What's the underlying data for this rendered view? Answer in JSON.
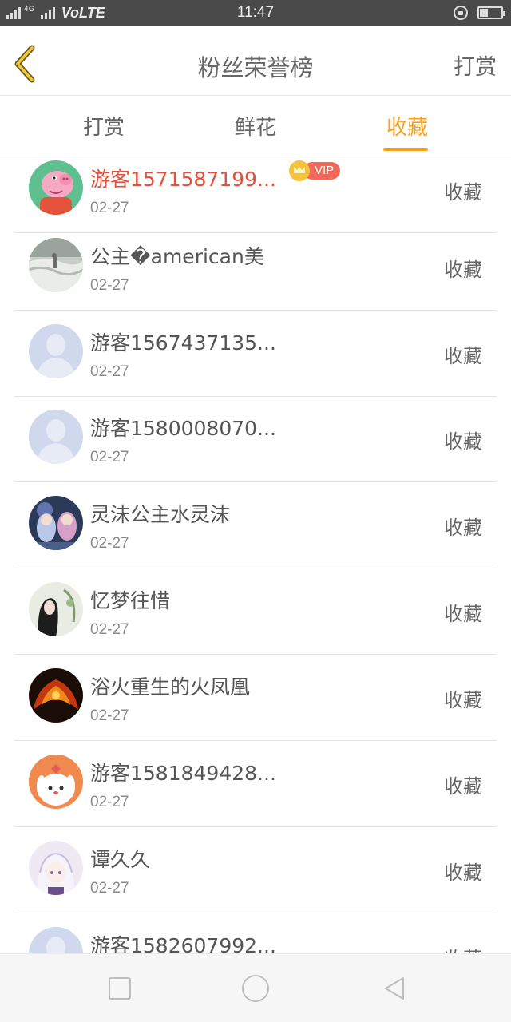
{
  "status_bar": {
    "network": "4G",
    "carrier_label": "VoLTE",
    "time": "11:47",
    "battery_level": 0.4
  },
  "header": {
    "title": "粉丝荣誉榜",
    "action_label": "打赏"
  },
  "tabs": [
    {
      "label": "打赏",
      "active": false
    },
    {
      "label": "鲜花",
      "active": false
    },
    {
      "label": "收藏",
      "active": true
    }
  ],
  "list": {
    "items": [
      {
        "name": "游客1571587199...",
        "date": "02-27",
        "action": "收藏",
        "highlight": true,
        "vip_label": "VIP",
        "avatar": "peppa-pig-avatar"
      },
      {
        "name": "公主�american美",
        "date": "02-27",
        "action": "收藏",
        "avatar": "photo-avatar"
      },
      {
        "name": "游客1567437135...",
        "date": "02-27",
        "action": "收藏",
        "avatar": "default-user-avatar"
      },
      {
        "name": "游客1580008070...",
        "date": "02-27",
        "action": "收藏",
        "avatar": "default-user-avatar"
      },
      {
        "name": "灵沫公主水灵沫",
        "date": "02-27",
        "action": "收藏",
        "avatar": "anime-girls-avatar"
      },
      {
        "name": "忆梦往惜",
        "date": "02-27",
        "action": "收藏",
        "avatar": "portrait-avatar"
      },
      {
        "name": "浴火重生的火凤凰",
        "date": "02-27",
        "action": "收藏",
        "avatar": "phoenix-avatar"
      },
      {
        "name": "游客1581849428...",
        "date": "02-27",
        "action": "收藏",
        "avatar": "cartoon-dog-avatar"
      },
      {
        "name": "谭久久",
        "date": "02-27",
        "action": "收藏",
        "avatar": "anime-avatar"
      },
      {
        "name": "游客1582607992...",
        "date": "",
        "action": "收藏",
        "avatar": "default-user-avatar"
      }
    ]
  },
  "colors": {
    "accent": "#f3a023",
    "highlight_name": "#e2513c",
    "vip": "#ef6a5a"
  }
}
